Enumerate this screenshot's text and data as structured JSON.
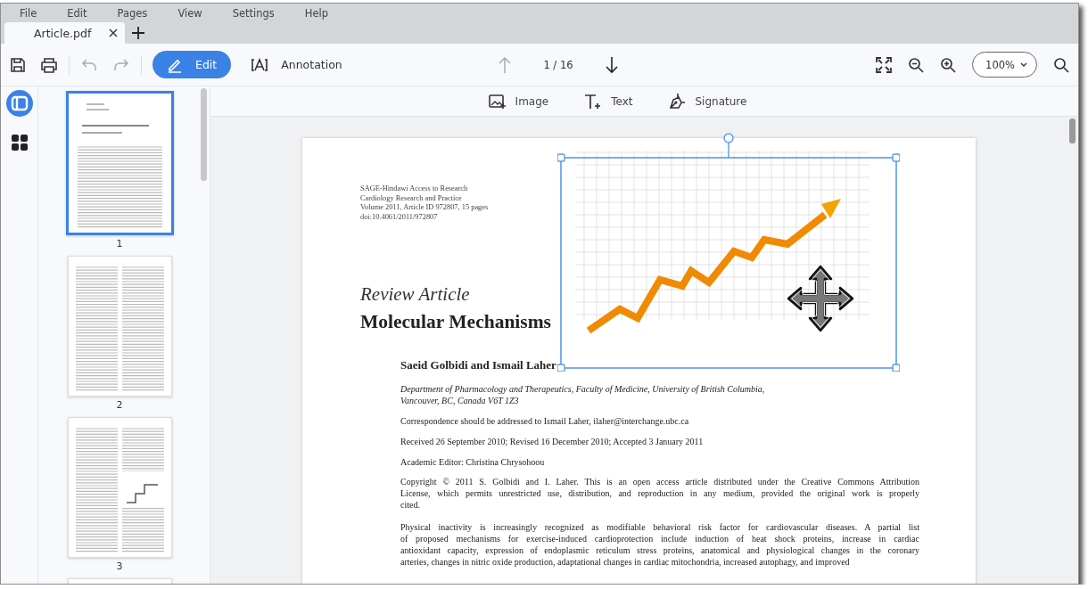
{
  "menu": [
    {
      "label": "File"
    },
    {
      "label": "Edit"
    },
    {
      "label": "Pages"
    },
    {
      "label": "View"
    },
    {
      "label": "Settings"
    },
    {
      "label": "Help"
    }
  ],
  "tabs": [
    {
      "label": "Article.pdf",
      "selected": true
    }
  ],
  "toolbar": {
    "modes": [
      {
        "label": "Edit",
        "kind": "edit",
        "selected": true
      },
      {
        "label": "Annotation",
        "kind": "annotation",
        "selected": false
      }
    ],
    "page_indicator": "1 / 16",
    "zoom": "100%"
  },
  "edit_tools": [
    {
      "label": "Image",
      "kind": "image"
    },
    {
      "label": "Text",
      "kind": "text"
    },
    {
      "label": "Signature",
      "kind": "signature"
    }
  ],
  "sidebar": {
    "views": [
      {
        "kind": "thumbnails",
        "selected": true
      },
      {
        "kind": "grid",
        "selected": false
      }
    ]
  },
  "thumbnails": [
    {
      "label": "1",
      "selected": true
    },
    {
      "label": "2",
      "selected": false
    },
    {
      "label": "3",
      "selected": false
    },
    {
      "selected": false
    }
  ],
  "document": {
    "header_lines": [
      "SAGE-Hindawi Access to Research",
      "Cardiology Research and Practice",
      "Volume 2011, Article ID 972807, 15 pages",
      "doi:10.4061/2011/972807"
    ],
    "article_type": "Review Article",
    "title": "Molecular Mechanisms",
    "authors": "Saeid Golbidi and Ismail Laher",
    "affiliation": [
      "Department of Pharmacology and Therapeutics, Faculty of Medicine, University of British Columbia,",
      "Vancouver, BC, Canada V6T 1Z3"
    ],
    "correspondence": "Correspondence should be addressed to Ismail Laher, ilaher@interchange.ubc.ca",
    "dates": "Received 26 September 2010; Revised 16 December 2010; Accepted 3 January 2011",
    "editor": "Academic Editor: Christina Chrysohoou",
    "copyright": [
      "Copyright © 2011 S. Golbidi and I. Laher. This is an open access article distributed under the Creative Commons Attribution",
      "License, which permits unrestricted use, distribution, and reproduction in any medium, provided the original work is properly",
      "cited."
    ],
    "body": [
      "Physical inactivity is increasingly recognized as modifiable behavioral risk factor for cardiovascular diseases. A partial list",
      "of proposed mechanisms for exercise-induced cardioprotection include induction of heat shock proteins, increase in cardiac",
      "antioxidant capacity, expression of endoplasmic reticulum stress proteins, anatomical and physiological changes in the coronary",
      "arteries, changes in nitric oxide production, adaptational changes in cardiac mitochondria, increased autophagy, and improved"
    ]
  }
}
